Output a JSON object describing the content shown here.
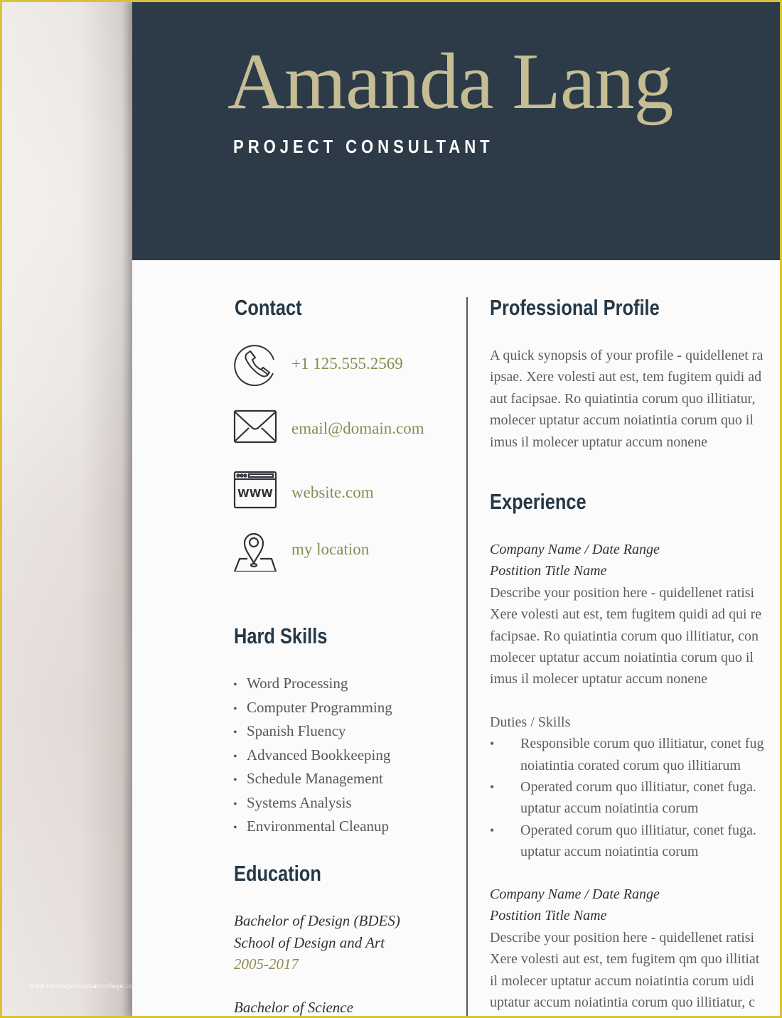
{
  "watermark": "www.heritagechristiancollege.com",
  "header": {
    "name": "Amanda Lang",
    "title": "PROJECT CONSULTANT"
  },
  "colors": {
    "header_bg": "#2c3b47",
    "name_gold": "#c6bd94",
    "accent_olive": "#8a8a52",
    "heading": "#263846",
    "frame_yellow": "#d9c23a"
  },
  "contact": {
    "heading": "Contact",
    "items": [
      {
        "icon": "phone-icon",
        "value": "+1 125.555.2569"
      },
      {
        "icon": "envelope-icon",
        "value": "email@domain.com"
      },
      {
        "icon": "website-icon",
        "value": "website.com"
      },
      {
        "icon": "map-pin-icon",
        "value": "my location"
      }
    ]
  },
  "hard_skills": {
    "heading": "Hard Skills",
    "bullet": "•",
    "items": [
      "Word Processing",
      "Computer Programming",
      "Spanish Fluency",
      "Advanced Bookkeeping",
      "Schedule Management",
      "Systems Analysis",
      "Environmental Cleanup"
    ]
  },
  "education": {
    "heading": "Education",
    "entries": [
      {
        "degree": "Bachelor of Design (BDES)",
        "school": "School of Design and Art",
        "years": "2005-2017"
      },
      {
        "degree": "Bachelor of Science"
      }
    ]
  },
  "profile": {
    "heading": "Professional Profile",
    "lines": [
      "A quick synopsis of your profile - quidellenet ra",
      "ipsae. Xere volesti aut est, tem fugitem quidi ad",
      "aut facipsae. Ro quiatintia corum quo illitiatur,",
      "molecer uptatur accum noiatintia corum quo il",
      "imus il molecer uptatur accum nonene"
    ]
  },
  "experience": {
    "heading": "Experience",
    "jobs": [
      {
        "company": "Company Name / Date Range",
        "position": "Postition Title Name",
        "lines": [
          "Describe your position here - quidellenet ratisi",
          "Xere volesti aut est, tem fugitem quidi ad qui re",
          "facipsae. Ro quiatintia corum quo illitiatur, con",
          "molecer uptatur accum noiatintia corum quo il",
          "imus il molecer uptatur accum nonene"
        ],
        "duties_title": "Duties / Skills",
        "duties": [
          [
            "Responsible corum quo illitiatur, conet fug",
            "noiatintia corated corum quo illitiarum"
          ],
          [
            "Operated corum quo illitiatur, conet fuga.",
            "uptatur accum noiatintia corum"
          ],
          [
            "Operated corum quo illitiatur, conet fuga.",
            "uptatur accum noiatintia corum"
          ]
        ]
      },
      {
        "company": "Company Name / Date Range",
        "position": "Postition Title Name",
        "lines": [
          "Describe your position here - quidellenet ratisi",
          "Xere volesti aut est, tem fugitem qm quo illitiat",
          "il molecer uptatur accum noiatintia corum uidi",
          "uptatur accum noiatintia corum quo illitiatur, c"
        ]
      }
    ]
  }
}
